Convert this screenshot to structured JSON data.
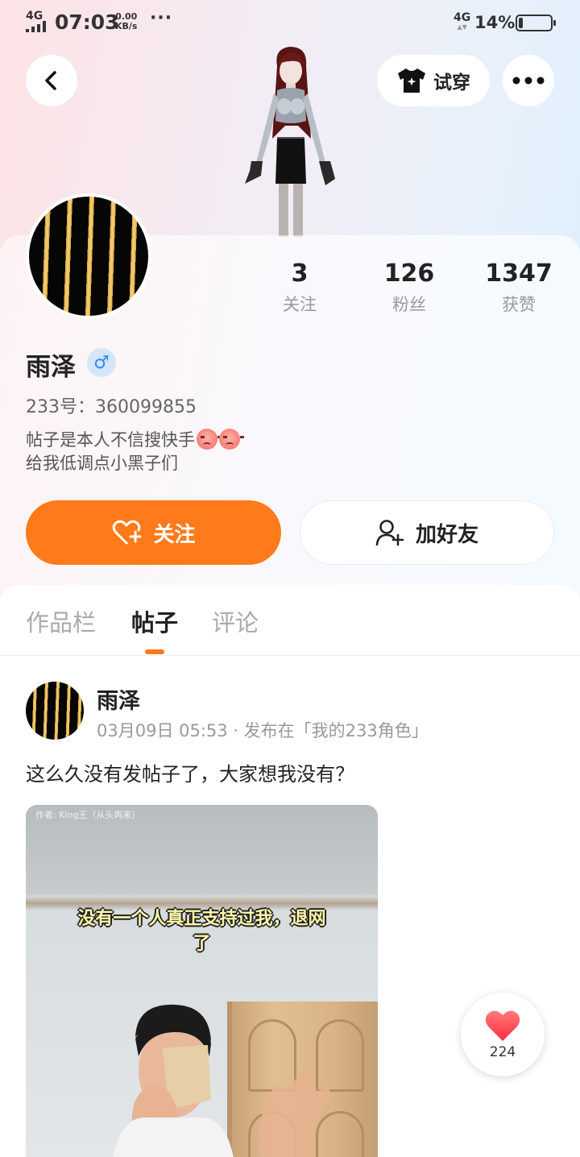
{
  "status_bar": {
    "network_left": "4G",
    "time": "07:03",
    "speed_value": "0.00",
    "speed_unit": "KB/s",
    "more": "···",
    "network_right": "4G",
    "battery_percent": "14%",
    "battery_level": 0.14
  },
  "header": {
    "try_on_label": "试穿"
  },
  "profile": {
    "name": "雨泽",
    "gender_symbol": "♂",
    "id_text": "233号：360099855",
    "bio_line1": "帖子是本人不信搜快手",
    "bio_line2": "给我低调点小黑子们",
    "stats": [
      {
        "value": "3",
        "label": "关注"
      },
      {
        "value": "126",
        "label": "粉丝"
      },
      {
        "value": "1347",
        "label": "获赞"
      }
    ],
    "follow_label": "关注",
    "add_friend_label": "加好友"
  },
  "tabs": [
    {
      "label": "作品栏",
      "active": false
    },
    {
      "label": "帖子",
      "active": true
    },
    {
      "label": "评论",
      "active": false
    }
  ],
  "post": {
    "author": "雨泽",
    "meta": "03月09日 05:53 · 发布在「我的233角色」",
    "text": "这么久没有发帖子了，大家想我没有？",
    "image_watermark": "作者: King王（从头再来）",
    "image_caption_line1": "没有一个人真正支持过我，退网",
    "image_caption_line2": "了",
    "like_count": "224"
  },
  "colors": {
    "accent": "#ff7a1a",
    "like_red": "#ff4757",
    "male_blue": "#2d8cf0"
  }
}
